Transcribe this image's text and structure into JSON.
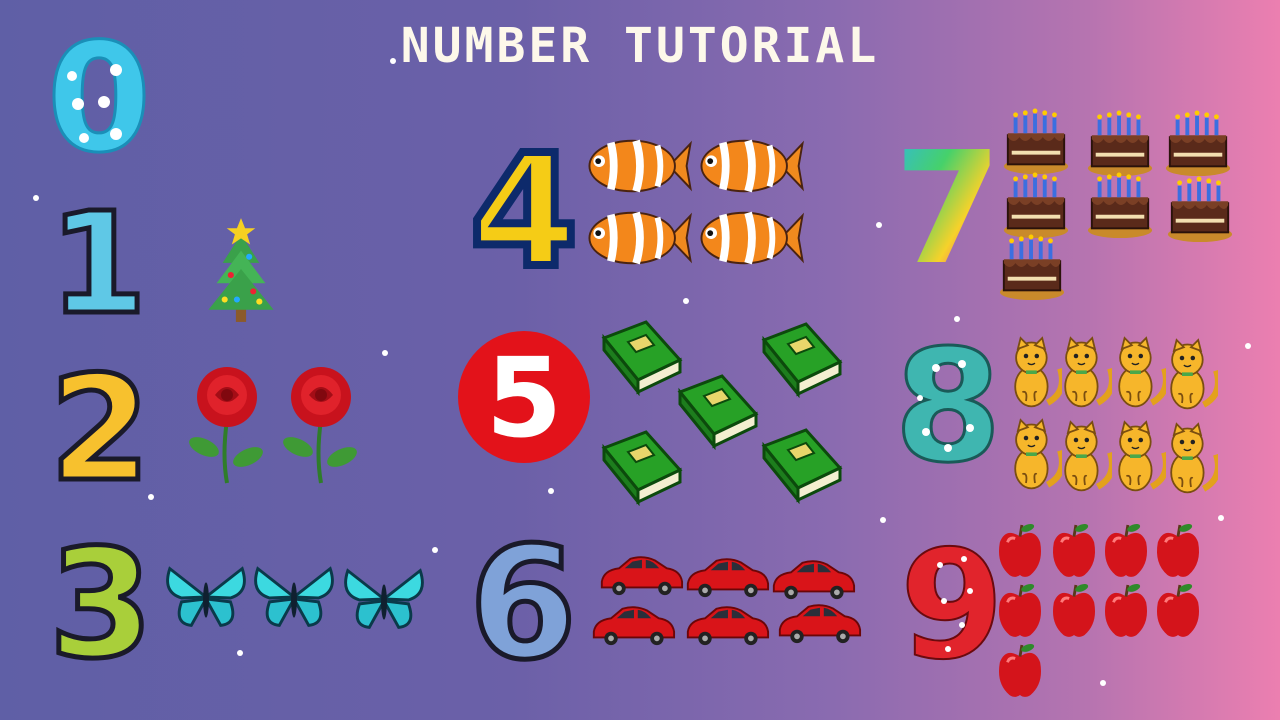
{
  "title": "NUMBER TUTORIAL",
  "numbers": [
    {
      "digit": "0",
      "object": "none",
      "count": 0
    },
    {
      "digit": "1",
      "object": "christmas-tree",
      "count": 1
    },
    {
      "digit": "2",
      "object": "rose",
      "count": 2
    },
    {
      "digit": "3",
      "object": "butterfly",
      "count": 3
    },
    {
      "digit": "4",
      "object": "clownfish",
      "count": 4
    },
    {
      "digit": "5",
      "object": "green-book",
      "count": 5
    },
    {
      "digit": "6",
      "object": "red-car",
      "count": 6
    },
    {
      "digit": "7",
      "object": "birthday-cake",
      "count": 7
    },
    {
      "digit": "8",
      "object": "cat",
      "count": 8
    },
    {
      "digit": "9",
      "object": "apple",
      "count": 9
    }
  ],
  "colors": {
    "background_left": "#5f5fa6",
    "background_right": "#ec7fb0",
    "title": "#fdf8ea",
    "zero": "#3fc7ea",
    "one": "#5fc8e6",
    "two": "#f7c12e",
    "three": "#a9cf3a",
    "four": "#f5cc16",
    "five_circle": "#e3121a",
    "six": "#7fa2d8",
    "eight": "#3fb6b0",
    "nine": "#e1242c"
  }
}
